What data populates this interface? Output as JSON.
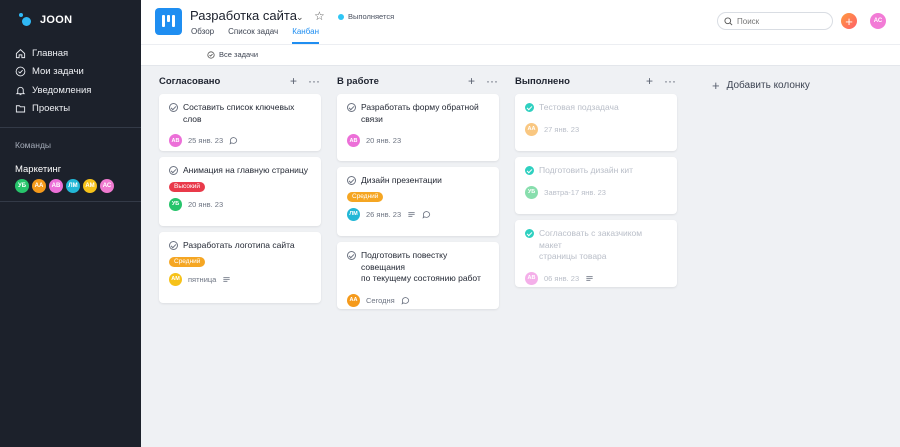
{
  "app": {
    "logo_text": "JOON"
  },
  "sidebar": {
    "items": [
      {
        "label": "Главная",
        "icon": "home-icon"
      },
      {
        "label": "Мои задачи",
        "icon": "check-circle-icon"
      },
      {
        "label": "Уведомления",
        "icon": "bell-icon"
      },
      {
        "label": "Проекты",
        "icon": "folder-icon"
      }
    ],
    "section_title": "Команды",
    "team_name": "Маркетинг",
    "team_members": [
      {
        "initials": "УБ",
        "color": "#27c46b"
      },
      {
        "initials": "АА",
        "color": "#f59a1b"
      },
      {
        "initials": "АВ",
        "color": "#ec6fd8"
      },
      {
        "initials": "ЛМ",
        "color": "#22b7d6"
      },
      {
        "initials": "АМ",
        "color": "#f6c21a"
      },
      {
        "initials": "АС",
        "color": "#f07ad0"
      }
    ]
  },
  "header": {
    "project_title": "Разработка сайта",
    "status": "Выполняется",
    "tabs": [
      {
        "label": "Обзор",
        "active": false
      },
      {
        "label": "Список задач",
        "active": false
      },
      {
        "label": "Канбан",
        "active": true
      }
    ],
    "search_placeholder": "Поиск",
    "user_initials": "АС"
  },
  "subheader": {
    "filter_label": "Все задачи"
  },
  "columns": [
    {
      "title": "Согласовано",
      "cards": [
        {
          "title": "Составить список ключевых слов",
          "avatar": "АВ",
          "avatar_color": "#ec6fd8",
          "date": "25 янв. 23",
          "comment": true
        },
        {
          "title": "Анимация на главную страницу",
          "tag": "Высокий",
          "avatar": "УБ",
          "avatar_color": "#27c46b",
          "date": "20 янв. 23"
        },
        {
          "title": "Разработать логотипа сайта",
          "tag": "Средний",
          "avatar": "АМ",
          "avatar_color": "#f6c21a",
          "date": "пятница",
          "description": true
        }
      ]
    },
    {
      "title": "В работе",
      "cards": [
        {
          "title_line1": "Разработать форму обратной",
          "title_line2": "связи",
          "avatar": "АВ",
          "avatar_color": "#ec6fd8",
          "date": "20 янв. 23"
        },
        {
          "title": "Дизайн презентации",
          "tag": "Средний",
          "avatar": "ЛМ",
          "avatar_color": "#22b7d6",
          "date": "26 янв. 23",
          "description": true,
          "comment": true
        },
        {
          "title_line1": "Подготовить повестку совещания",
          "title_line2": "по текущему состоянию работ",
          "avatar": "АА",
          "avatar_color": "#f59a1b",
          "date": "Сегодня",
          "comment": true
        }
      ]
    },
    {
      "title": "Выполнено",
      "cards": [
        {
          "title": "Тестовая подзадача",
          "avatar": "АА",
          "avatar_color": "#f59a1b",
          "date": "27 янв. 23"
        },
        {
          "title": "Подготовить дизайн кит",
          "avatar": "УБ",
          "avatar_color": "#27c46b",
          "date": "Завтра-17 янв. 23"
        },
        {
          "title_line1": "Согласовать с заказчиком макет",
          "title_line2": "страницы товара",
          "avatar": "АВ",
          "avatar_color": "#ec6fd8",
          "date": "06 янв. 23",
          "description": true
        }
      ]
    }
  ],
  "add_column_label": "Добавить колонку"
}
